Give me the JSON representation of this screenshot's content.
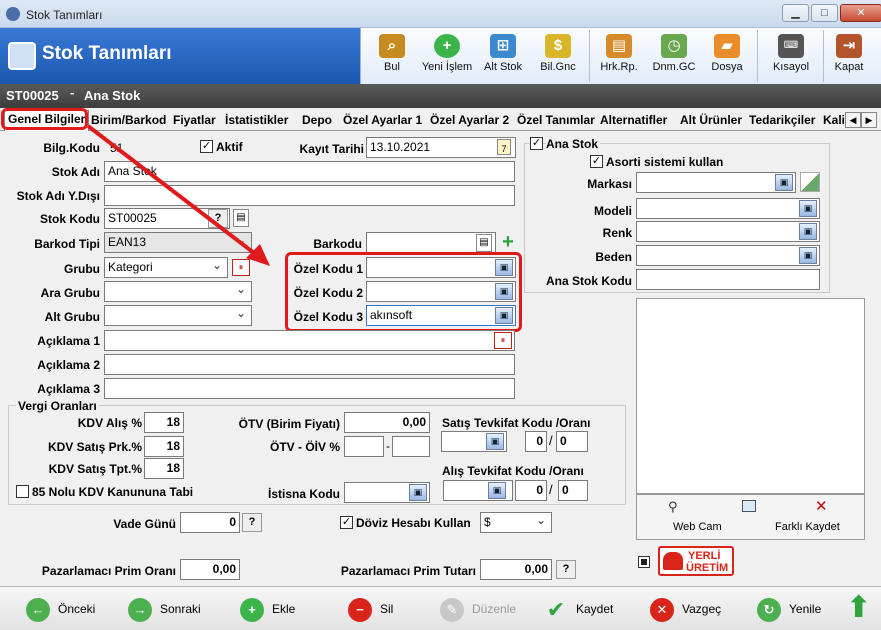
{
  "window": {
    "title": "Stok Tanımları"
  },
  "header": {
    "title": "Stok Tanımları"
  },
  "toolbar": {
    "items": [
      {
        "label": "Bul",
        "icon": "binoculars-icon"
      },
      {
        "label": "Yeni İşlem",
        "icon": "plus-icon"
      },
      {
        "label": "Alt Stok",
        "icon": "network-icon"
      },
      {
        "label": "Bil.Gnc",
        "icon": "coins-icon"
      },
      {
        "label": "Hrk.Rp.",
        "icon": "document-icon"
      },
      {
        "label": "Dnm.GC",
        "icon": "clock-icon"
      },
      {
        "label": "Dosya",
        "icon": "folder-icon"
      },
      {
        "label": "Kısayol",
        "icon": "keyboard-icon"
      },
      {
        "label": "Kapat",
        "icon": "exit-icon"
      }
    ]
  },
  "record": {
    "code": "ST00025",
    "separator": "-",
    "name": "Ana Stok"
  },
  "tabs": [
    "Genel Bilgiler",
    "Birim/Barkod",
    "Fiyatlar",
    "İstatistikler",
    "Depo",
    "Özel Ayarlar 1",
    "Özel Ayarlar 2",
    "Özel Tanımlar",
    "Alternatifler",
    "Alt Ürünler",
    "Tedarikçiler",
    "Kali"
  ],
  "form": {
    "bilg_kodu_label": "Bilg.Kodu",
    "bilg_kodu_value": "51",
    "aktif_label": "Aktif",
    "kayit_tarihi_label": "Kayıt Tarihi",
    "kayit_tarihi_value": "13.10.2021",
    "stok_adi_label": "Stok Adı",
    "stok_adi_value": "Ana Stok",
    "stok_adi_yd_label": "Stok Adı Y.Dışı",
    "stok_adi_yd_value": "",
    "stok_kodu_label": "Stok Kodu",
    "stok_kodu_value": "ST00025",
    "barkod_tipi_label": "Barkod Tipi",
    "barkod_tipi_value": "EAN13",
    "barkodu_label": "Barkodu",
    "barkodu_value": "",
    "grubu_label": "Grubu",
    "grubu_value": "Kategori",
    "ara_grubu_label": "Ara Grubu",
    "ara_grubu_value": "",
    "alt_grubu_label": "Alt Grubu",
    "alt_grubu_value": "",
    "ozel_kodu_1_label": "Özel Kodu 1",
    "ozel_kodu_1_value": "",
    "ozel_kodu_2_label": "Özel Kodu 2",
    "ozel_kodu_2_value": "",
    "ozel_kodu_3_label": "Özel Kodu 3",
    "ozel_kodu_3_value": "akınsoft",
    "aciklama_1_label": "Açıklama 1",
    "aciklama_2_label": "Açıklama 2",
    "aciklama_3_label": "Açıklama 3",
    "question": "?"
  },
  "vergi": {
    "title": "Vergi Oranları",
    "kdv_alis_label": "KDV Alış %",
    "kdv_alis_value": "18",
    "kdv_satis_prk_label": "KDV Satış Prk.%",
    "kdv_satis_prk_value": "18",
    "kdv_satis_tpt_label": "KDV Satış Tpt.%",
    "kdv_satis_tpt_value": "18",
    "kanun_label": "85 Nolu KDV Kanununa Tabi",
    "otv_label": "ÖTV (Birim Fiyatı)",
    "otv_value": "0,00",
    "otv_oiv_label": "ÖTV - ÖİV %",
    "otv_oiv_dash": "-",
    "istisna_label": "İstisna Kodu",
    "satis_tevkifat_label": "Satış Tevkifat Kodu /Oranı",
    "satis_tevkifat_num": "0",
    "satis_tevkifat_den": "0",
    "alis_tevkifat_label": "Alış Tevkifat Kodu /Oranı",
    "alis_tevkifat_num": "0",
    "alis_tevkifat_den": "0",
    "slash": "/"
  },
  "lower": {
    "vade_gunu_label": "Vade Günü",
    "vade_gunu_value": "0",
    "doviz_label": "Döviz Hesabı Kullan",
    "doviz_value": "$",
    "prim_orani_label": "Pazarlamacı Prim Oranı",
    "prim_orani_value": "0,00",
    "prim_tutari_label": "Pazarlamacı Prim Tutarı",
    "prim_tutari_value": "0,00"
  },
  "right": {
    "ana_stok_label": "Ana Stok",
    "asorti_label": "Asorti sistemi kullan",
    "markasi_label": "Markası",
    "modeli_label": "Modeli",
    "renk_label": "Renk",
    "beden_label": "Beden",
    "ana_stok_kodu_label": "Ana Stok Kodu",
    "web_cam_label": "Web Cam",
    "farkli_kaydet_label": "Farklı Kaydet",
    "yerli_line1": "YERLİ",
    "yerli_line2": "ÜRETİM"
  },
  "bottom": {
    "onceki": "Önceki",
    "sonraki": "Sonraki",
    "ekle": "Ekle",
    "sil": "Sil",
    "duzenle": "Düzenle",
    "kaydet": "Kaydet",
    "vazgec": "Vazgeç",
    "yenile": "Yenile"
  },
  "colors": {
    "header": "#1a56b0",
    "highlight": "#e0191b",
    "add": "#3bb54a",
    "delete": "#d9241a"
  }
}
